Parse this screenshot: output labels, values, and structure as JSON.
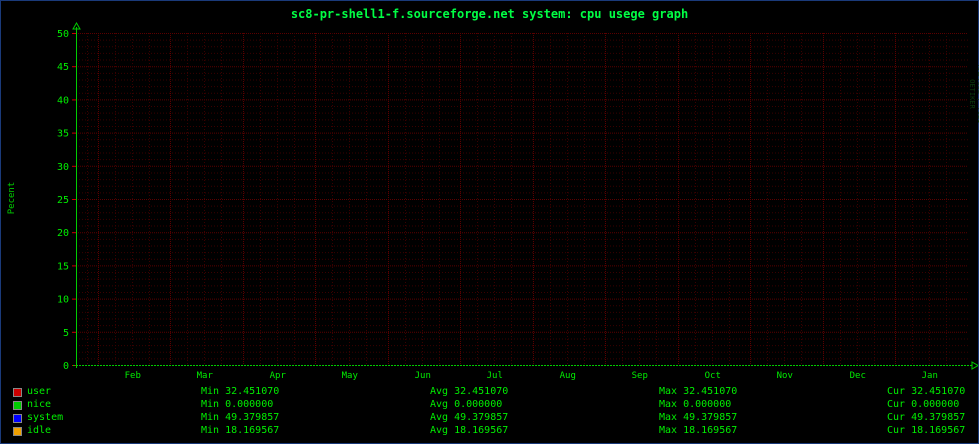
{
  "chart_data": {
    "type": "line",
    "title": "sc8-pr-shell1-f.sourceforge.net system: cpu usege graph",
    "ylabel": "Pecent",
    "xlabel": "",
    "categories": [
      "Feb",
      "Mar",
      "Apr",
      "May",
      "Jun",
      "Jul",
      "Aug",
      "Sep",
      "Oct",
      "Nov",
      "Dec",
      "Jan"
    ],
    "ylim": [
      0,
      50
    ],
    "yticks": [
      "0",
      "5",
      "10",
      "15",
      "20",
      "25",
      "30",
      "35",
      "40",
      "45",
      "50"
    ],
    "grid": true,
    "legend_position": "bottom",
    "series": [
      {
        "name": "user",
        "color": "#cc0000",
        "values": [],
        "min": "Min 32.451070",
        "avg": "Avg 32.451070",
        "max": "Max 32.451070",
        "cur": "Cur 32.451070"
      },
      {
        "name": "nice",
        "color": "#00cc00",
        "values": [],
        "min": "Min 0.000000",
        "avg": "Avg 0.000000",
        "max": "Max 0.000000",
        "cur": "Cur 0.000000"
      },
      {
        "name": "system",
        "color": "#0000ff",
        "values": [],
        "min": "Min 49.379857",
        "avg": "Avg 49.379857",
        "max": "Max 49.379857",
        "cur": "Cur 49.379857"
      },
      {
        "name": "idle",
        "color": "#f0a000",
        "values": [],
        "min": "Min 18.169567",
        "avg": "Avg 18.169567",
        "max": "Max 18.169567",
        "cur": "Cur 18.169567"
      }
    ]
  },
  "watermark": "RRDTOOL / TOBI OETIKER",
  "colors": {
    "background": "#000000",
    "major_grid": "#5a0000",
    "minor_grid": "#3a0000",
    "axis_text": "#00ee00",
    "border": "#1a3a7a"
  }
}
